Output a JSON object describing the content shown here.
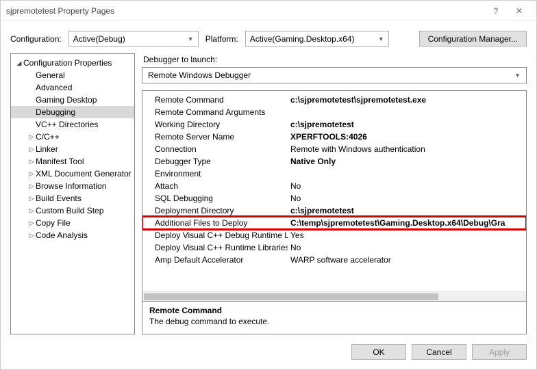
{
  "window": {
    "title": "sjpremotetest Property Pages"
  },
  "configRow": {
    "configLabel": "Configuration:",
    "configValue": "Active(Debug)",
    "platformLabel": "Platform:",
    "platformValue": "Active(Gaming.Desktop.x64)",
    "managerBtn": "Configuration Manager..."
  },
  "tree": {
    "root": "Configuration Properties",
    "items": [
      {
        "label": "General",
        "expandable": false
      },
      {
        "label": "Advanced",
        "expandable": false
      },
      {
        "label": "Gaming Desktop",
        "expandable": false
      },
      {
        "label": "Debugging",
        "expandable": false,
        "selected": true
      },
      {
        "label": "VC++ Directories",
        "expandable": false
      },
      {
        "label": "C/C++",
        "expandable": true
      },
      {
        "label": "Linker",
        "expandable": true
      },
      {
        "label": "Manifest Tool",
        "expandable": true
      },
      {
        "label": "XML Document Generator",
        "expandable": true
      },
      {
        "label": "Browse Information",
        "expandable": true
      },
      {
        "label": "Build Events",
        "expandable": true
      },
      {
        "label": "Custom Build Step",
        "expandable": true
      },
      {
        "label": "Copy File",
        "expandable": true
      },
      {
        "label": "Code Analysis",
        "expandable": true
      }
    ]
  },
  "launch": {
    "label": "Debugger to launch:",
    "value": "Remote Windows Debugger"
  },
  "grid": [
    {
      "k": "Remote Command",
      "v": "c:\\sjpremotetest\\sjpremotetest.exe",
      "bold": true
    },
    {
      "k": "Remote Command Arguments",
      "v": ""
    },
    {
      "k": "Working Directory",
      "v": "c:\\sjpremotetest",
      "bold": true
    },
    {
      "k": "Remote Server Name",
      "v": "XPERFTOOLS:4026",
      "bold": true
    },
    {
      "k": "Connection",
      "v": "Remote with Windows authentication"
    },
    {
      "k": "Debugger Type",
      "v": "Native Only",
      "bold": true
    },
    {
      "k": "Environment",
      "v": ""
    },
    {
      "k": "Attach",
      "v": "No"
    },
    {
      "k": "SQL Debugging",
      "v": "No"
    },
    {
      "k": "Deployment Directory",
      "v": "c:\\sjpremotetest",
      "bold": true
    },
    {
      "k": "Additional Files to Deploy",
      "v": "C:\\temp\\sjpremotetest\\Gaming.Desktop.x64\\Debug\\Gra",
      "bold": true,
      "hl": true
    },
    {
      "k": "Deploy Visual C++ Debug Runtime Libraries",
      "v": "Yes"
    },
    {
      "k": "Deploy Visual C++ Runtime Libraries",
      "v": "No"
    },
    {
      "k": "Amp Default Accelerator",
      "v": "WARP software accelerator"
    }
  ],
  "desc": {
    "title": "Remote Command",
    "text": "The debug command to execute."
  },
  "footer": {
    "ok": "OK",
    "cancel": "Cancel",
    "apply": "Apply"
  }
}
